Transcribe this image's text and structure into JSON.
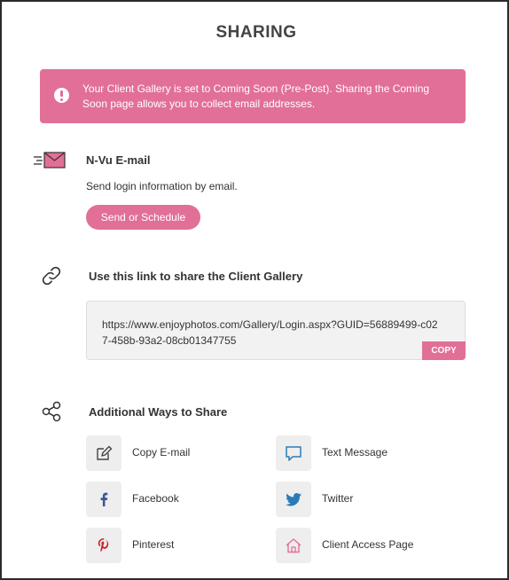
{
  "title": "SHARING",
  "alert": {
    "icon": "exclamation-icon",
    "text": "Your Client Gallery is set to Coming Soon (Pre-Post). Sharing the Coming Soon page allows you to collect email addresses."
  },
  "email_section": {
    "icon": "envelope-icon",
    "title": "N-Vu E-mail",
    "description": "Send login information by email.",
    "button_label": "Send or Schedule"
  },
  "link_section": {
    "icon": "link-icon",
    "title": "Use this link to share the Client Gallery",
    "url": "https://www.enjoyphotos.com/Gallery/Login.aspx?GUID=56889499-c027-458b-93a2-08cb01347755",
    "copy_label": "COPY"
  },
  "additional_section": {
    "icon": "share-icon",
    "title": "Additional Ways to Share",
    "items": [
      {
        "label": "Copy E-mail",
        "icon": "edit-icon"
      },
      {
        "label": "Text Message",
        "icon": "chat-icon"
      },
      {
        "label": "Facebook",
        "icon": "facebook-icon"
      },
      {
        "label": "Twitter",
        "icon": "twitter-icon"
      },
      {
        "label": "Pinterest",
        "icon": "pinterest-icon"
      },
      {
        "label": "Client Access Page",
        "icon": "home-icon"
      }
    ]
  },
  "colors": {
    "accent": "#e26f98",
    "facebook": "#3b5998",
    "twitter": "#2b7bb9",
    "pinterest": "#cb2027",
    "icon_bg": "#eeeeee"
  }
}
